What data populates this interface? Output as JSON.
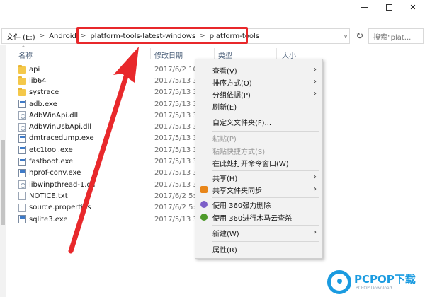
{
  "window": {
    "minimize_glyph": "—",
    "close_glyph": "✕"
  },
  "address_bar": {
    "segments": [
      "文件 (E:)",
      "Android",
      "platform-tools-latest-windows",
      "platform-tools"
    ],
    "separator": ">",
    "dropdown_glyph": "∨",
    "refresh_glyph": "↻"
  },
  "search": {
    "text": "搜索\"plat...",
    "icon": "search-icon"
  },
  "columns": {
    "name": "名称",
    "modified": "修改日期",
    "type": "类型",
    "size": "大小"
  },
  "files": [
    {
      "name": "api",
      "kind": "folder",
      "date": "2017/6/2 10:"
    },
    {
      "name": "lib64",
      "kind": "folder",
      "date": "2017/5/13 3:"
    },
    {
      "name": "systrace",
      "kind": "folder",
      "date": "2017/5/13 3:"
    },
    {
      "name": "adb.exe",
      "kind": "exe",
      "date": "2017/5/13 3:"
    },
    {
      "name": "AdbWinApi.dll",
      "kind": "dll",
      "date": "2017/5/13 3:"
    },
    {
      "name": "AdbWinUsbApi.dll",
      "kind": "dll",
      "date": "2017/5/13 3:"
    },
    {
      "name": "dmtracedump.exe",
      "kind": "exe",
      "date": "2017/5/13 3:"
    },
    {
      "name": "etc1tool.exe",
      "kind": "exe",
      "date": "2017/5/13 3:"
    },
    {
      "name": "fastboot.exe",
      "kind": "exe",
      "date": "2017/5/13 3:"
    },
    {
      "name": "hprof-conv.exe",
      "kind": "exe",
      "date": "2017/5/13 3:"
    },
    {
      "name": "libwinpthread-1.dll",
      "kind": "dll",
      "date": "2017/5/13 3:"
    },
    {
      "name": "NOTICE.txt",
      "kind": "file",
      "date": "2017/6/2 5:3"
    },
    {
      "name": "source.properties",
      "kind": "file",
      "date": "2017/6/2 5:3"
    },
    {
      "name": "sqlite3.exe",
      "kind": "exe",
      "date": "2017/5/13 3:"
    }
  ],
  "context_menu": {
    "view": "查看(V)",
    "sort": "排序方式(O)",
    "group": "分组依据(P)",
    "refresh": "刷新(E)",
    "customize": "自定义文件夹(F)...",
    "paste": "粘贴(P)",
    "paste_shortcut": "粘贴快捷方式(S)",
    "open_cmd": "在此处打开命令窗口(W)",
    "share": "共享(H)",
    "sync": "共享文件夹同步",
    "del360": "使用 360强力删除",
    "scan360": "使用 360进行木马云查杀",
    "new": "新建(W)",
    "properties": "属性(R)",
    "submenu_glyph": "›"
  },
  "watermark": {
    "brand": "PCPOP下载",
    "sub": "PCPOP Download"
  },
  "colors": {
    "highlight_red": "#e8282b",
    "folder_yellow": "#f4c84a",
    "watermark_blue": "#1a9be0"
  }
}
